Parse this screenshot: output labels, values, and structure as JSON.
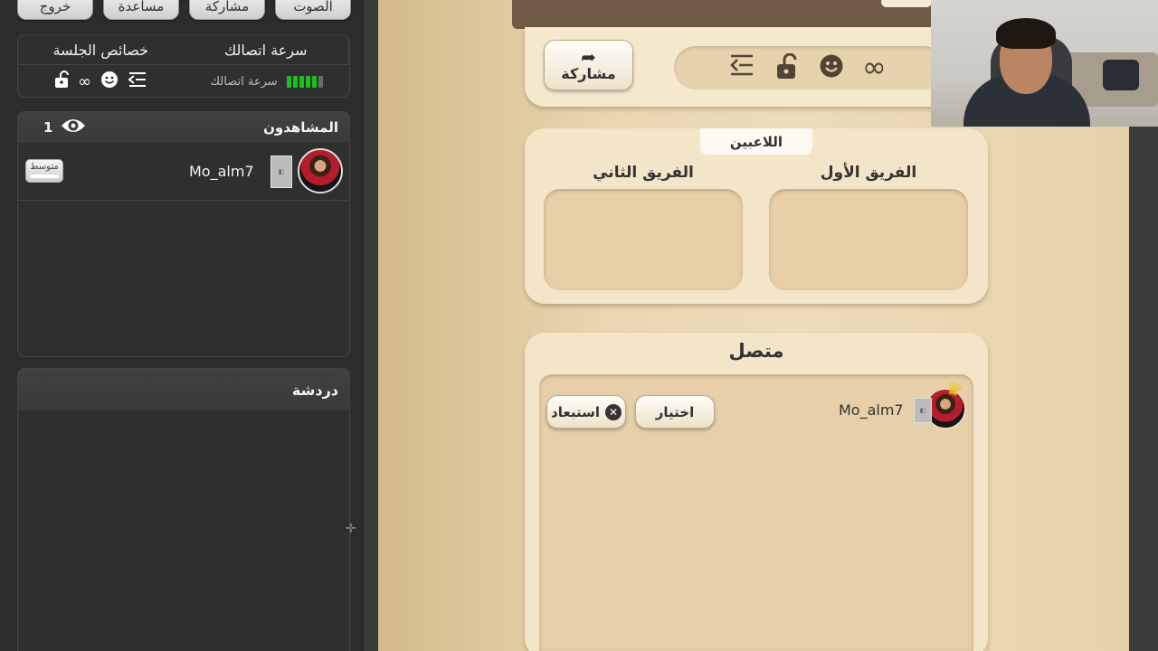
{
  "sidebar": {
    "top_buttons": {
      "exit": "خروج",
      "help": "مساعدة",
      "share": "مشاركة",
      "sound": "الصوت"
    },
    "connection_panel": {
      "speed_header": "سرعة اتصالك",
      "session_header": "خصائص الجلسة",
      "speed_value": "سرعة اتصالك",
      "session_icons": [
        "unlock-icon",
        "infinity-icon",
        "smiley-icon",
        "indent-arrow-icon"
      ]
    },
    "viewers": {
      "title": "المشاهدون",
      "count": "1",
      "items": [
        {
          "username": "Mo_alm7",
          "level": "متوسط"
        }
      ]
    },
    "chat": {
      "title": "دردشة"
    }
  },
  "game": {
    "share_button": "مشاركة",
    "session_props_icons": [
      "indent-arrow-icon",
      "unlock-icon",
      "smiley-icon",
      "infinity-icon"
    ],
    "players": {
      "tab_label": "اللاعبين",
      "team_one": "الفريق الأول",
      "team_two": "الفريق الثاني"
    },
    "online": {
      "title": "متصل",
      "users": [
        {
          "username": "Mo_alm7",
          "is_host": true
        }
      ],
      "select_button": "اختيار",
      "kick_button": "استبعاد"
    }
  },
  "colors": {
    "signal_green": "#19c21c",
    "crown_gold": "#f0c419",
    "panel_dark": "#2f2f2f",
    "card_cream": "#f3e5c8"
  }
}
